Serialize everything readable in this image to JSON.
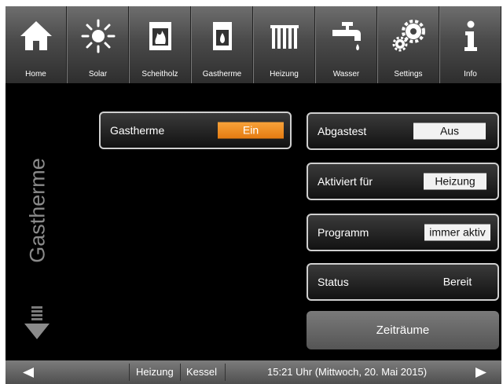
{
  "nav": {
    "items": [
      {
        "label": "Home",
        "icon": "house-icon"
      },
      {
        "label": "Solar",
        "icon": "sun-icon"
      },
      {
        "label": "Scheitholz",
        "icon": "wood-stove-icon"
      },
      {
        "label": "Gastherme",
        "icon": "gas-boiler-icon"
      },
      {
        "label": "Heizung",
        "icon": "radiator-icon"
      },
      {
        "label": "Wasser",
        "icon": "faucet-icon"
      },
      {
        "label": "Settings",
        "icon": "gears-icon"
      },
      {
        "label": "Info",
        "icon": "info-icon"
      }
    ]
  },
  "sidebar": {
    "title": "Gastherme"
  },
  "controls": {
    "gastherme": {
      "label": "Gastherme",
      "value": "Ein"
    },
    "abgastest": {
      "label": "Abgastest",
      "value": "Aus"
    },
    "aktiviert": {
      "label": "Aktiviert für",
      "value": "Heizung"
    },
    "programm": {
      "label": "Programm",
      "value": "immer aktiv"
    },
    "status": {
      "label": "Status",
      "value": "Bereit"
    },
    "zeitraeume": {
      "label": "Zeiträume"
    }
  },
  "footer": {
    "crumb1": "Heizung",
    "crumb2": "Kessel",
    "datetime": "15:21 Uhr (Mittwoch, 20. Mai 2015)"
  },
  "colors": {
    "accent": "#f08c1e",
    "background": "#000000"
  }
}
